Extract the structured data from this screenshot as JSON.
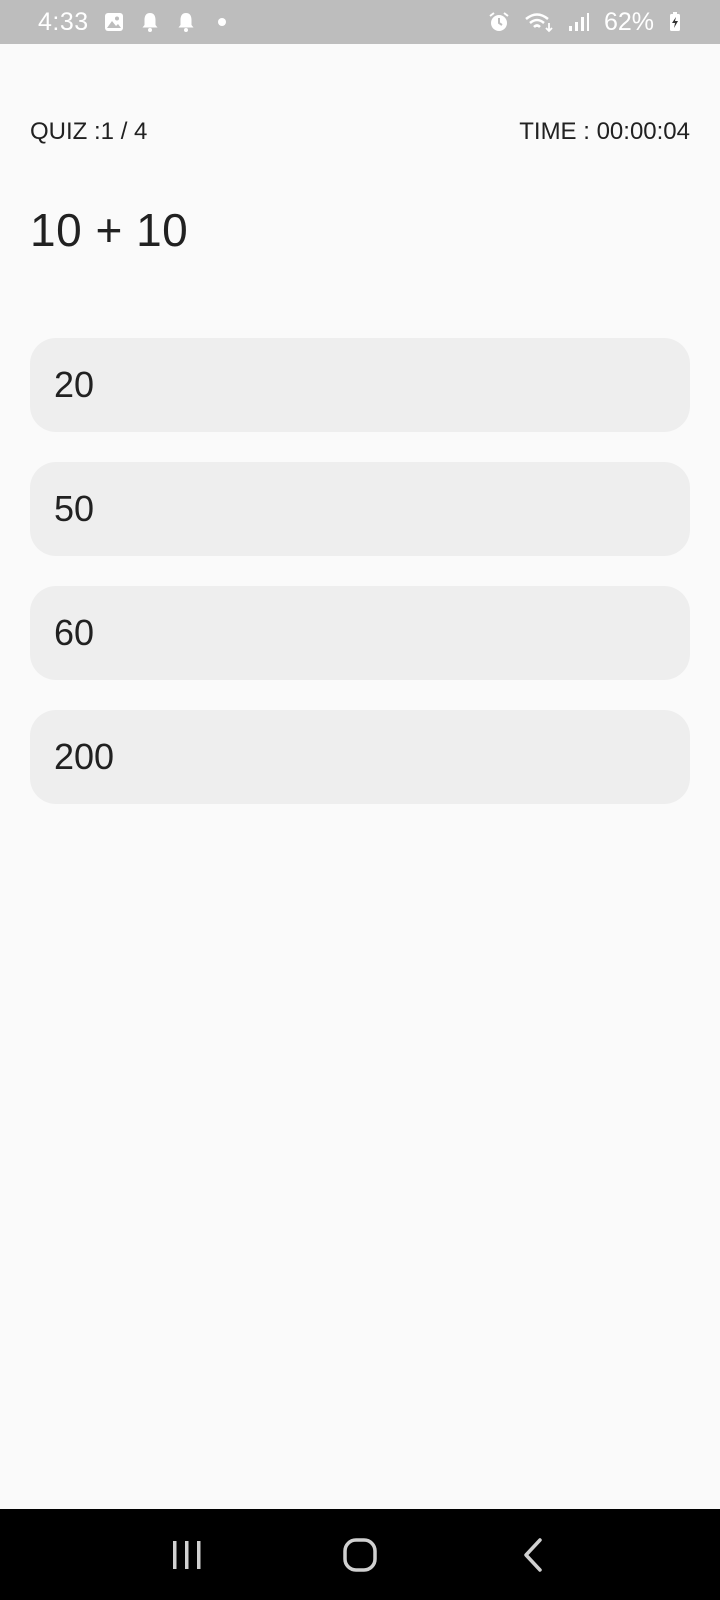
{
  "status_bar": {
    "time": "4:33",
    "battery_percent": "62%",
    "icons": [
      "image-icon",
      "notification-bell-icon",
      "notification-bell-icon",
      "dot-icon",
      "alarm-icon",
      "wifi-icon",
      "signal-icon",
      "battery-charging-icon"
    ]
  },
  "quiz": {
    "progress_label": "QUIZ :",
    "progress_value": "1 / 4",
    "time_label": "TIME : ",
    "time_value": "00:00:04",
    "question": "10 + 10",
    "options": [
      "20",
      "50",
      "60",
      "200"
    ]
  },
  "nav_bar": {
    "icons": [
      "recent-apps-icon",
      "home-icon",
      "back-icon"
    ]
  },
  "colors": {
    "status_bar_bg": "#bdbdbd",
    "page_bg": "#fafafa",
    "option_bg": "#eeeeee",
    "text": "#212121",
    "nav_bar_bg": "#000000"
  }
}
